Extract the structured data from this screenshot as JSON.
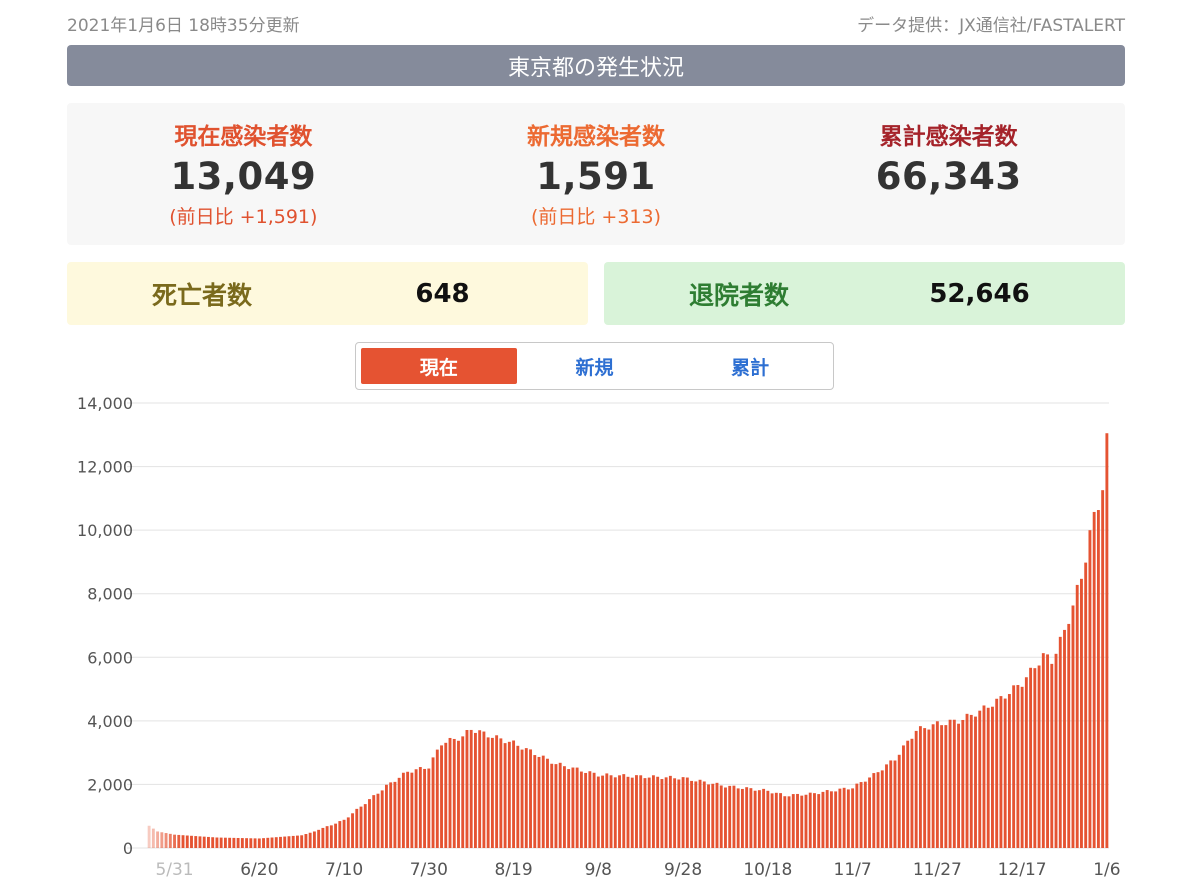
{
  "header": {
    "updated": "2021年1月6日 18時35分更新",
    "source": "データ提供：JX通信社/FASTALERT",
    "title": "東京都の発生状況"
  },
  "stats": {
    "current": {
      "label": "現在感染者数",
      "value": "13,049",
      "diff": "(前日比 +1,591)"
    },
    "new": {
      "label": "新規感染者数",
      "value": "1,591",
      "diff": "(前日比 +313)"
    },
    "total": {
      "label": "累計感染者数",
      "value": "66,343"
    }
  },
  "deaths": {
    "label": "死亡者数",
    "value": "648"
  },
  "recovered": {
    "label": "退院者数",
    "value": "52,646"
  },
  "tabs": [
    {
      "label": "現在",
      "active": true
    },
    {
      "label": "新規",
      "active": false
    },
    {
      "label": "累計",
      "active": false
    }
  ],
  "colors": {
    "bar": "#e55332",
    "accent_red": "#e0522f",
    "accent_orange": "#ec6a32",
    "accent_dark": "#a5232a",
    "grid": "#e3e3e3",
    "tab_link": "#2d6fd2"
  },
  "chart_data": {
    "type": "bar",
    "title": "",
    "xlabel": "",
    "ylabel": "",
    "ylim": [
      0,
      14000
    ],
    "yticks": [
      0,
      2000,
      4000,
      6000,
      8000,
      10000,
      12000,
      14000
    ],
    "ytick_labels": [
      "0",
      "2,000",
      "4,000",
      "6,000",
      "8,000",
      "10,000",
      "12,000",
      "14,000"
    ],
    "xtick_labels": [
      "5/31",
      "6/20",
      "7/10",
      "7/30",
      "8/19",
      "9/8",
      "9/28",
      "10/18",
      "11/7",
      "11/27",
      "12/17",
      "1/6"
    ],
    "grid": true,
    "start_date": "2020-05-25",
    "end_date": "2021-01-06",
    "keyframes": [
      [
        "2020-05-25",
        700
      ],
      [
        "2020-05-27",
        520
      ],
      [
        "2020-05-31",
        420
      ],
      [
        "2020-06-10",
        330
      ],
      [
        "2020-06-20",
        300
      ],
      [
        "2020-06-30",
        400
      ],
      [
        "2020-07-03",
        520
      ],
      [
        "2020-07-10",
        880
      ],
      [
        "2020-07-20",
        1950
      ],
      [
        "2020-07-25",
        2400
      ],
      [
        "2020-07-30",
        2550
      ],
      [
        "2020-08-02",
        3300
      ],
      [
        "2020-08-07",
        3500
      ],
      [
        "2020-08-09",
        3750
      ],
      [
        "2020-08-13",
        3550
      ],
      [
        "2020-08-19",
        3300
      ],
      [
        "2020-08-29",
        2650
      ],
      [
        "2020-09-08",
        2300
      ],
      [
        "2020-09-18",
        2250
      ],
      [
        "2020-09-28",
        2200
      ],
      [
        "2020-10-08",
        1950
      ],
      [
        "2020-10-18",
        1800
      ],
      [
        "2020-10-22",
        1650
      ],
      [
        "2020-10-28",
        1700
      ],
      [
        "2020-11-07",
        1900
      ],
      [
        "2020-11-12",
        2300
      ],
      [
        "2020-11-17",
        2800
      ],
      [
        "2020-11-22",
        3700
      ],
      [
        "2020-11-27",
        3900
      ],
      [
        "2020-12-02",
        4000
      ],
      [
        "2020-12-07",
        4300
      ],
      [
        "2020-12-12",
        4700
      ],
      [
        "2020-12-17",
        5200
      ],
      [
        "2020-12-20",
        5700
      ],
      [
        "2020-12-22",
        6050
      ],
      [
        "2020-12-24",
        5900
      ],
      [
        "2020-12-27",
        6800
      ],
      [
        "2020-12-31",
        8500
      ],
      [
        "2021-01-02",
        9900
      ],
      [
        "2021-01-04",
        10800
      ],
      [
        "2021-01-05",
        11458
      ],
      [
        "2021-01-06",
        13049
      ]
    ]
  }
}
